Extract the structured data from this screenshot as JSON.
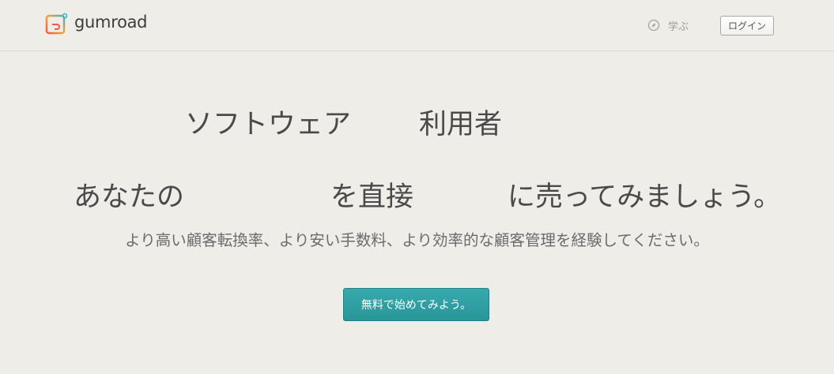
{
  "brand": {
    "name": "gumroad",
    "logo_icon": "gumroad-logo-icon"
  },
  "nav": {
    "learn_label": "学ぶ",
    "learn_icon": "compass-icon",
    "login_label": "ログイン"
  },
  "hero": {
    "row1": {
      "word1": "ソフトウェア",
      "word2": "利用者"
    },
    "row2": {
      "part1": "あなたの",
      "part2": "を直接",
      "part3": "に売ってみましょう。"
    },
    "subtitle": "より高い顧客転換率、より安い手数料、より効率的な顧客管理を経験してください。",
    "cta_label": "無料で始めてみよう。"
  },
  "colors": {
    "background": "#eeede8",
    "cta": "#2e9ea2",
    "text": "#4a4a4a"
  }
}
